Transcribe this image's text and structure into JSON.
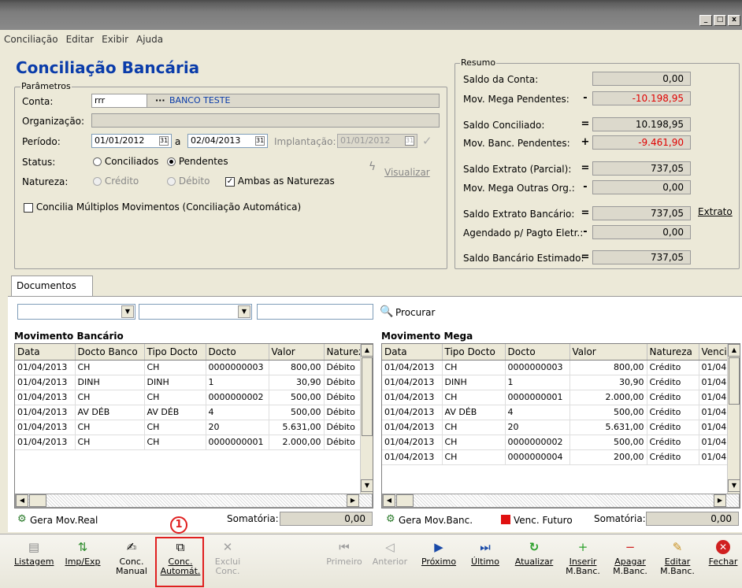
{
  "window": {
    "buttons": [
      "_",
      "□",
      "x"
    ]
  },
  "menu": [
    "Conciliação",
    "Editar",
    "Exibir",
    "Ajuda"
  ],
  "app_title": "Conciliação Bancária",
  "params": {
    "legend": "Parâmetros",
    "conta_label": "Conta:",
    "conta_value": "rrr",
    "conta_dots": "···",
    "conta_name": "BANCO TESTE",
    "org_label": "Organização:",
    "org_value": "",
    "periodo_label": "Período:",
    "periodo_from": "01/01/2012",
    "periodo_sep": "a",
    "periodo_to": "02/04/2013",
    "implantacao_label": "Implantação:",
    "implantacao_value": "01/01/2012",
    "status_label": "Status:",
    "status_opt1": "Conciliados",
    "status_opt2": "Pendentes",
    "natureza_label": "Natureza:",
    "natureza_opt1": "Crédito",
    "natureza_opt2": "Débito",
    "natureza_chk": "Ambas as Naturezas",
    "multi_chk": "Concilia Múltiplos Movimentos (Conciliação Automática)",
    "visualizar": "Visualizar"
  },
  "resumo": {
    "legend": "Resumo",
    "rows": [
      {
        "label": "Saldo da Conta:",
        "op": "",
        "value": "0,00",
        "red": false
      },
      {
        "label": "Mov. Mega Pendentes:",
        "op": "-",
        "value": "-10.198,95",
        "red": true
      },
      {
        "label": "Saldo Conciliado:",
        "op": "=",
        "value": "10.198,95",
        "red": false
      },
      {
        "label": "Mov. Banc. Pendentes:",
        "op": "+",
        "value": "-9.461,90",
        "red": true
      },
      {
        "label": "Saldo Extrato (Parcial):",
        "op": "=",
        "value": "737,05",
        "red": false
      },
      {
        "label": "Mov. Mega Outras Org.:",
        "op": "-",
        "value": "0,00",
        "red": false
      },
      {
        "label": "Saldo Extrato Bancário:",
        "op": "=",
        "value": "737,05",
        "red": false
      },
      {
        "label": "Agendado p/ Pagto Eletr.:",
        "op": "-",
        "value": "0,00",
        "red": false
      },
      {
        "label": "Saldo Bancário Estimado:",
        "op": "=",
        "value": "737,05",
        "red": false
      }
    ],
    "extrato_link": "Extrato"
  },
  "documentos_tab": "Documentos",
  "procurar": "Procurar",
  "banco": {
    "title": "Movimento Bancário",
    "headers": [
      "Data",
      "Docto Banco",
      "Tipo Docto",
      "Docto",
      "Valor",
      "Natureza"
    ],
    "rows": [
      [
        "01/04/2013",
        "CH",
        "CH",
        "0000000003",
        "800,00",
        "Débito"
      ],
      [
        "01/04/2013",
        "DINH",
        "DINH",
        "1",
        "30,90",
        "Débito"
      ],
      [
        "01/04/2013",
        "CH",
        "CH",
        "0000000002",
        "500,00",
        "Débito"
      ],
      [
        "01/04/2013",
        "AV DÉB",
        "AV DÉB",
        "4",
        "500,00",
        "Débito"
      ],
      [
        "01/04/2013",
        "CH",
        "CH",
        "20",
        "5.631,00",
        "Débito"
      ],
      [
        "01/04/2013",
        "CH",
        "CH",
        "0000000001",
        "2.000,00",
        "Débito"
      ]
    ],
    "gera": "Gera Mov.Real",
    "somatoria_label": "Somatória:",
    "somatoria_value": "0,00"
  },
  "mega": {
    "title": "Movimento Mega",
    "headers": [
      "Data",
      "Tipo Docto",
      "Docto",
      "Valor",
      "Natureza",
      "Vencimento"
    ],
    "rows": [
      [
        "01/04/2013",
        "CH",
        "0000000003",
        "800,00",
        "Crédito",
        "01/04"
      ],
      [
        "01/04/2013",
        "DINH",
        "1",
        "30,90",
        "Crédito",
        "01/04"
      ],
      [
        "01/04/2013",
        "CH",
        "0000000001",
        "2.000,00",
        "Crédito",
        "01/04"
      ],
      [
        "01/04/2013",
        "AV DÉB",
        "4",
        "500,00",
        "Crédito",
        "01/04"
      ],
      [
        "01/04/2013",
        "CH",
        "20",
        "5.631,00",
        "Crédito",
        "01/04"
      ],
      [
        "01/04/2013",
        "CH",
        "0000000002",
        "500,00",
        "Crédito",
        "01/04"
      ],
      [
        "01/04/2013",
        "CH",
        "0000000004",
        "200,00",
        "Crédito",
        "01/04"
      ]
    ],
    "gera": "Gera Mov.Banc.",
    "venc_futuro": "Venc. Futuro",
    "somatoria_label": "Somatória:",
    "somatoria_value": "0,00"
  },
  "annotation": "1",
  "colors": {
    "title_blue": "#0a3caa",
    "negative_red": "#e00000",
    "highlight_red": "#e02020"
  },
  "toolbar": {
    "listagem": "Listagem",
    "impexp": "Imp/Exp",
    "conc_manual_1": "Conc.",
    "conc_manual_2": "Manual",
    "conc_auto_1": "Conc.",
    "conc_auto_2": "Automát.",
    "exclui_1": "Exclui",
    "exclui_2": "Conc.",
    "primeiro": "Primeiro",
    "anterior": "Anterior",
    "proximo": "Próximo",
    "ultimo": "Último",
    "atualizar": "Atualizar",
    "inserir_1": "Inserir",
    "inserir_2": "M.Banc.",
    "apagar_1": "Apagar",
    "apagar_2": "M.Banc.",
    "editar_1": "Editar",
    "editar_2": "M.Banc.",
    "fechar": "Fechar"
  }
}
